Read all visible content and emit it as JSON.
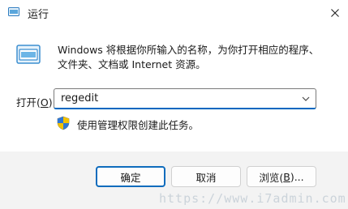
{
  "window": {
    "title": "运行",
    "close_icon": "close-icon"
  },
  "content": {
    "description_line1": "Windows 将根据你所输入的名称，为你打开相应的程序、",
    "description_line2": "文件夹、文档或 Internet 资源。",
    "open_label": "打开(O):",
    "open_label_text": "打开(",
    "open_label_key": "O",
    "open_label_suffix": "):",
    "command_value": "regedit",
    "admin_note": "使用管理权限创建此任务。"
  },
  "buttons": {
    "ok": "确定",
    "cancel": "取消",
    "browse": "浏览(B)...",
    "browse_text": "浏览(",
    "browse_key": "B",
    "browse_suffix": ")..."
  },
  "watermark": "https://www.i7admin.com",
  "colors": {
    "accent": "#0067c0",
    "button_border_default": "#0f6cbd",
    "background": "#f3f3f3"
  }
}
